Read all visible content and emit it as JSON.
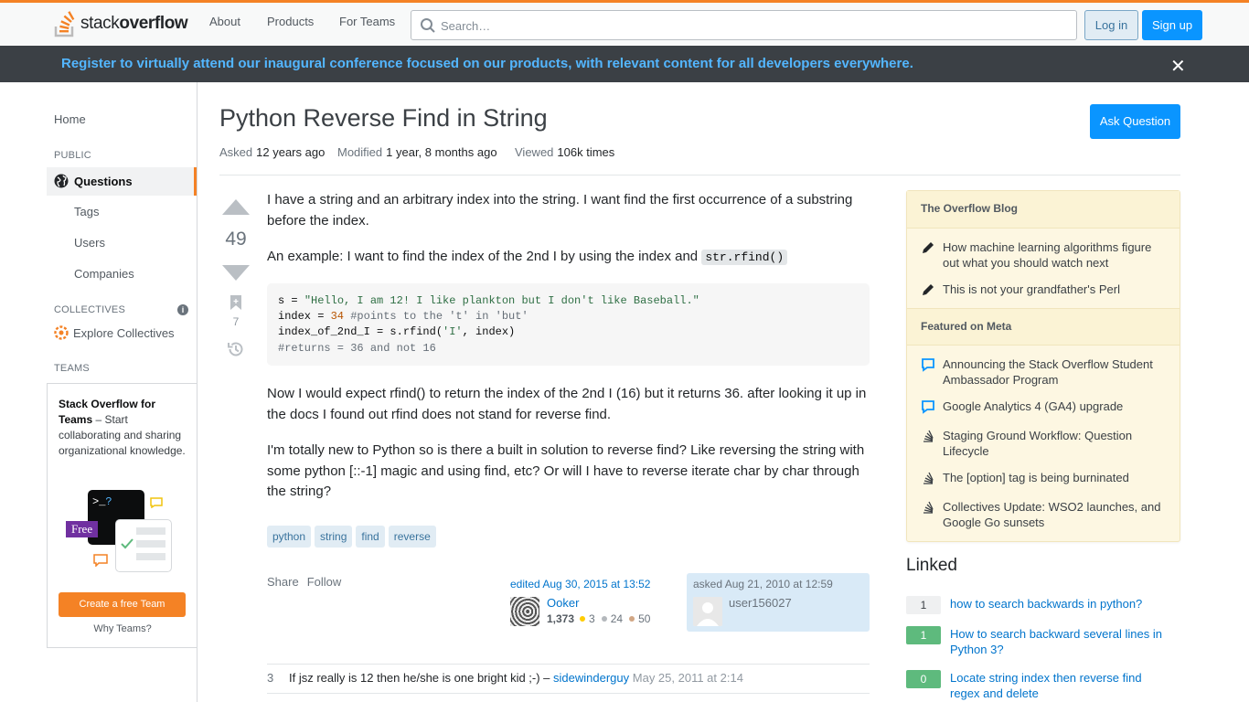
{
  "header": {
    "logo_text_light": "stack",
    "logo_text_bold": "overflow",
    "nav": [
      "About",
      "Products",
      "For Teams"
    ],
    "search_placeholder": "Search…",
    "login_label": "Log in",
    "signup_label": "Sign up"
  },
  "banner": {
    "text": "Register to virtually attend our inaugural conference focused on our products, with relevant content for all developers everywhere.",
    "close_glyph": "✕"
  },
  "sidebar": {
    "home": "Home",
    "public_label": "PUBLIC",
    "questions": "Questions",
    "tags": "Tags",
    "users": "Users",
    "companies": "Companies",
    "collectives_label": "COLLECTIVES",
    "explore_collectives": "Explore Collectives",
    "teams_label": "TEAMS",
    "teams_title": "Stack Overflow for Teams",
    "teams_desc": " – Start collaborating and sharing organizational knowledge.",
    "free_badge": "Free",
    "create_team": "Create a free Team",
    "why_teams": "Why Teams?"
  },
  "question": {
    "title": "Python Reverse Find in String",
    "ask_button": "Ask Question",
    "asked_label": "Asked",
    "asked_value": "12 years ago",
    "modified_label": "Modified",
    "modified_value": "1 year, 8 months ago",
    "viewed_label": "Viewed",
    "viewed_value": "106k times",
    "votes": "49",
    "bookmarks": "7",
    "para1": "I have a string and an arbitrary index into the string. I want find the first occurrence of a substring before the index.",
    "para2_prefix": "An example: I want to find the index of the 2nd I by using the index and ",
    "para2_code": "str.rfind()",
    "para3": "Now I would expect rfind() to return the index of the 2nd I (16) but it returns 36. after looking it up in the docs I found out rfind does not stand for reverse find.",
    "para4": "I'm totally new to Python so is there a built in solution to reverse find? Like reversing the string with some python [::-1] magic and using find, etc? Or will I have to reverse iterate char by char through the string?",
    "code": {
      "l1_a": "s = ",
      "l1_str": "\"Hello, I am 12! I like plankton but I don't like Baseball.\"",
      "l2_a": "index = ",
      "l2_num": "34",
      "l2_com": " #points to the 't' in 'but'",
      "l3_a": "index_of_2nd_I = s.rfind(",
      "l3_str": "'I'",
      "l3_b": ", index)",
      "l4_com": "#returns = 36 and not 16"
    },
    "tags": [
      "python",
      "string",
      "find",
      "reverse"
    ],
    "share": "Share",
    "follow": "Follow",
    "edited_action": "edited Aug 30, 2015 at 13:52",
    "editor_name": "Ooker",
    "editor_rep": "1,373",
    "editor_gold": "3",
    "editor_silver": "24",
    "editor_bronze": "50",
    "asked_action": "asked Aug 21, 2010 at 12:59",
    "asker_name": "user156027"
  },
  "comment": {
    "score": "3",
    "text": "If jsz really is 12 then he/she is one bright kid ;-) – ",
    "user": "sidewinderguy",
    "date": "May 25, 2011 at 2:14"
  },
  "blog": {
    "blog_heading": "The Overflow Blog",
    "blog_items": [
      "How machine learning algorithms figure out what you should watch next",
      "This is not your grandfather's Perl"
    ],
    "meta_heading": "Featured on Meta",
    "meta_items": [
      "Announcing the Stack Overflow Student Ambassador Program",
      "Google Analytics 4 (GA4) upgrade",
      "Staging Ground Workflow: Question Lifecycle",
      "The [option] tag is being burninated",
      "Collectives Update: WSO2 launches, and Google Go sunsets"
    ]
  },
  "linked": {
    "heading": "Linked",
    "items": [
      {
        "score": "1",
        "title": "how to search backwards in python?"
      },
      {
        "score": "1",
        "title": "How to search backward several lines in Python 3?"
      },
      {
        "score": "0",
        "title": "Locate string index then reverse find regex and delete"
      }
    ]
  },
  "colors": {
    "accent_orange": "#f48225",
    "primary_blue": "#0a95ff",
    "banner_bg": "#3b4045",
    "banner_text": "#53b6ff",
    "accepted_green": "#5eba7d"
  }
}
